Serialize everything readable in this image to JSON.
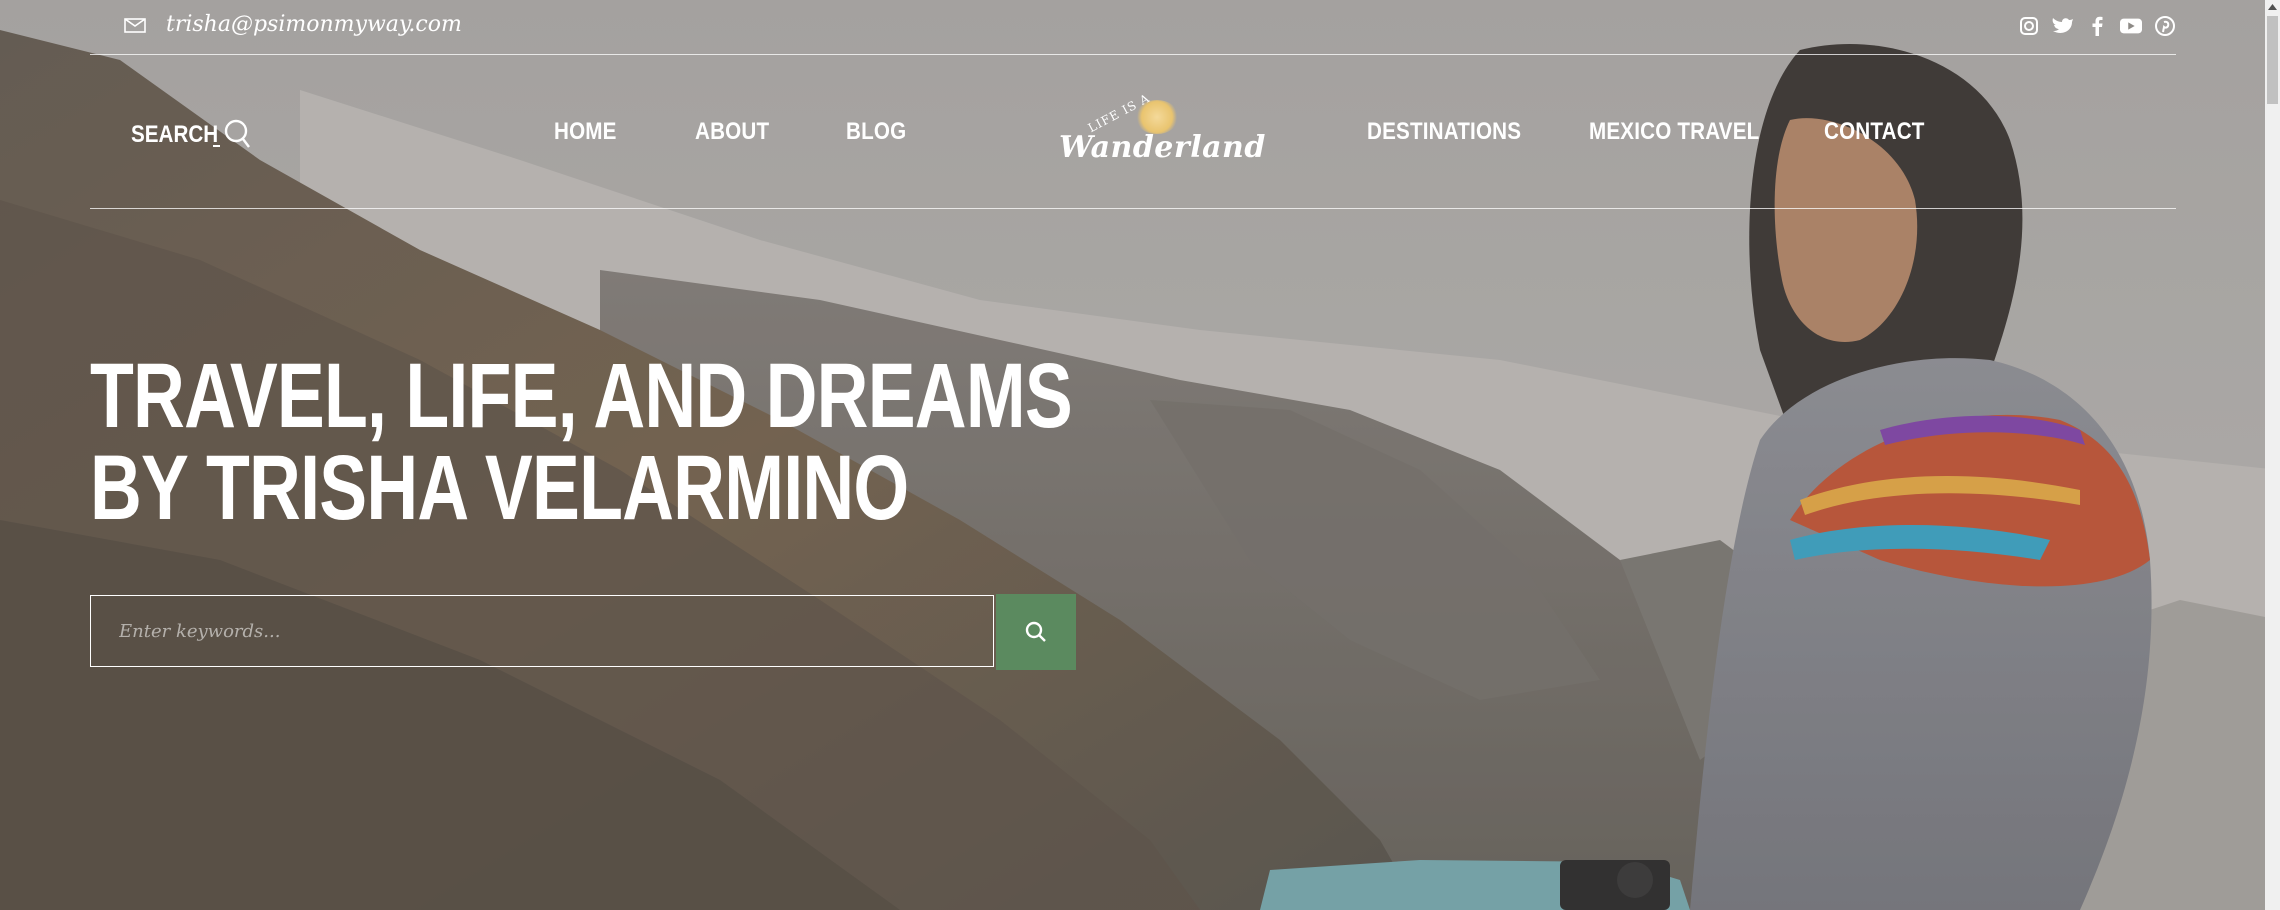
{
  "topbar": {
    "email": "trisha@psimonmyway.com",
    "social_icons": [
      "instagram-icon",
      "twitter-icon",
      "facebook-icon",
      "youtube-icon",
      "pinterest-icon"
    ]
  },
  "nav": {
    "search_label": "SEARCH",
    "items": [
      "HOME",
      "ABOUT",
      "BLOG",
      "DESTINATIONS",
      "MEXICO TRAVEL",
      "CONTACT"
    ]
  },
  "logo": {
    "small_text": "LIFE IS A",
    "script_text": "Wanderland"
  },
  "hero": {
    "title_line1": "TRAVEL, LIFE, AND DREAMS",
    "title_line2": "BY TRISHA VELARMINO"
  },
  "search": {
    "placeholder": "Enter keywords..."
  },
  "colors": {
    "accent_green": "#5b8a5f",
    "overlay": "#8d8a86"
  }
}
